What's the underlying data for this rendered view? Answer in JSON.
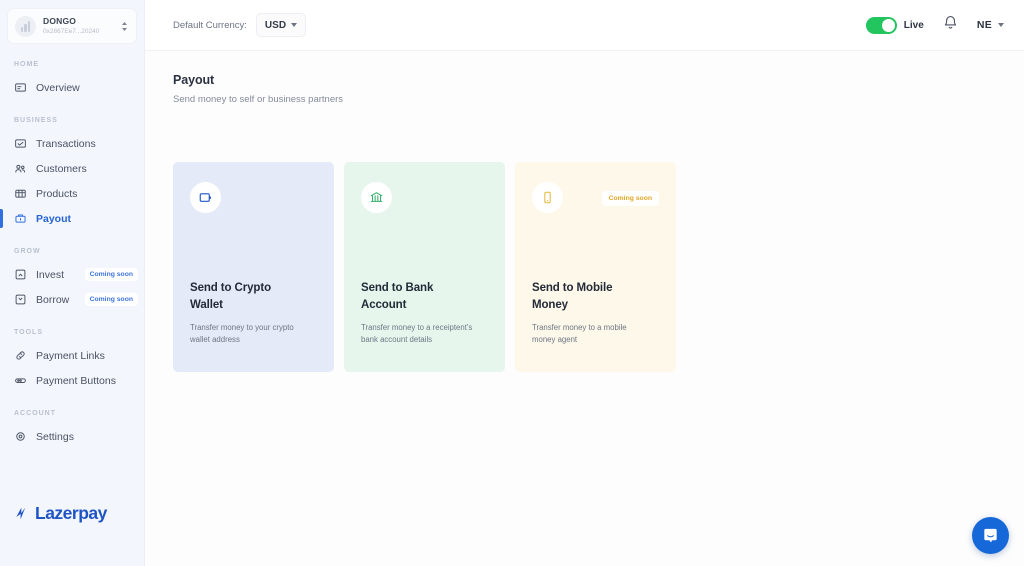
{
  "sidebar": {
    "account": {
      "name": "DONGO",
      "address": "0x2867Ee7...20240",
      "avatar_icon": "bar-chart-avatar",
      "switcher_icon": "up-down-chevrons-icon"
    },
    "sections": [
      {
        "label": "HOME",
        "items": [
          {
            "label": "Overview",
            "icon": "overview-icon",
            "active": false,
            "badge": ""
          }
        ]
      },
      {
        "label": "BUSINESS",
        "items": [
          {
            "label": "Transactions",
            "icon": "transactions-icon",
            "active": false,
            "badge": ""
          },
          {
            "label": "Customers",
            "icon": "customers-icon",
            "active": false,
            "badge": ""
          },
          {
            "label": "Products",
            "icon": "products-icon",
            "active": false,
            "badge": ""
          },
          {
            "label": "Payout",
            "icon": "payout-icon",
            "active": true,
            "badge": ""
          }
        ]
      },
      {
        "label": "GROW",
        "items": [
          {
            "label": "Invest",
            "icon": "invest-icon",
            "active": false,
            "badge": "Coming soon"
          },
          {
            "label": "Borrow",
            "icon": "borrow-icon",
            "active": false,
            "badge": "Coming soon"
          }
        ]
      },
      {
        "label": "TOOLS",
        "items": [
          {
            "label": "Payment Links",
            "icon": "link-icon",
            "active": false,
            "badge": ""
          },
          {
            "label": "Payment Buttons",
            "icon": "button-icon",
            "active": false,
            "badge": ""
          }
        ]
      },
      {
        "label": "ACCOUNT",
        "items": [
          {
            "label": "Settings",
            "icon": "gear-icon",
            "active": false,
            "badge": ""
          }
        ]
      }
    ],
    "brand": {
      "name": "Lazerpay",
      "logo_icon": "lazerpay-logo-icon",
      "color": "#1f54c4"
    }
  },
  "topbar": {
    "currency_label": "Default Currency:",
    "currency_value": "USD",
    "currency_caret_icon": "chevron-down-icon",
    "mode_toggle": {
      "label": "Live",
      "on": true,
      "color": "#22c55e"
    },
    "notifications_icon": "bell-icon",
    "user": {
      "initials": "NE",
      "caret_icon": "chevron-down-icon"
    }
  },
  "page": {
    "title": "Payout",
    "subtitle": "Send money to self or business partners"
  },
  "cards": [
    {
      "title": "Send to Crypto Wallet",
      "description": "Transfer money to your crypto wallet address",
      "icon": "wallet-icon",
      "badge": "",
      "bg": "#e4eaf7",
      "icon_color": "#1f54c4"
    },
    {
      "title": "Send to Bank Account",
      "description": "Transfer money to a receiptent's bank account details",
      "icon": "bank-icon",
      "badge": "",
      "bg": "#e6f6ec",
      "icon_color": "#34b06a"
    },
    {
      "title": "Send to Mobile Money",
      "description": "Transfer money to a mobile money agent",
      "icon": "mobile-phone-icon",
      "badge": "Coming soon",
      "bg": "#fdf8e9",
      "icon_color": "#e6b93f"
    }
  ],
  "chat": {
    "icon": "intercom-chat-icon",
    "color": "#1668d8"
  }
}
